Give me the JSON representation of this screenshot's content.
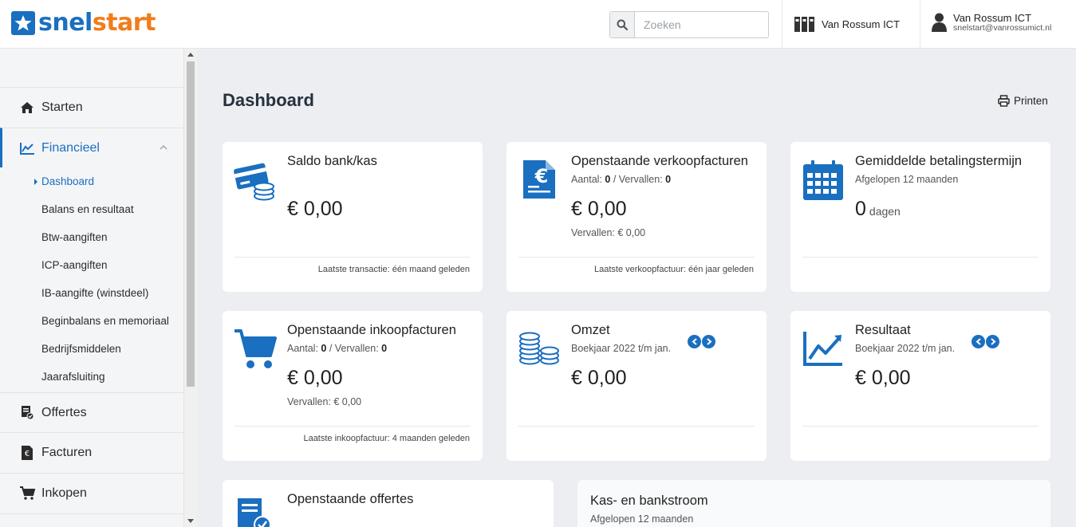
{
  "brand": {
    "part1": "snel",
    "part2": "start",
    "primary": "#1a6fc0",
    "accent": "#f07d1b"
  },
  "header": {
    "search_placeholder": "Zoeken",
    "company_name": "Van Rossum ICT",
    "user_name": "Van Rossum ICT",
    "user_email": "snelstart@vanrossumict.nl"
  },
  "sidebar": {
    "items": [
      {
        "label": "Starten",
        "icon": "home-icon"
      },
      {
        "label": "Financieel",
        "icon": "chart-line-icon"
      },
      {
        "label": "Offertes",
        "icon": "quote-doc-icon"
      },
      {
        "label": "Facturen",
        "icon": "invoice-euro-icon"
      },
      {
        "label": "Inkopen",
        "icon": "cart-icon"
      }
    ],
    "sub_items": [
      "Dashboard",
      "Balans en resultaat",
      "Btw-aangiften",
      "ICP-aangiften",
      "IB-aangifte (winstdeel)",
      "Beginbalans en memoriaal",
      "Bedrijfsmiddelen",
      "Jaarafsluiting"
    ],
    "active_sub": "Dashboard"
  },
  "main": {
    "title": "Dashboard",
    "print_label": "Printen",
    "cards": {
      "saldo": {
        "title": "Saldo bank/kas",
        "value": "€ 0,00",
        "footer": "Laatste transactie: één maand geleden"
      },
      "verkoop": {
        "title": "Openstaande verkoopfacturen",
        "count_label": "Aantal:",
        "count": "0",
        "overdue_label": "/ Vervallen:",
        "overdue": "0",
        "value": "€ 0,00",
        "extra": "Vervallen: € 0,00",
        "footer": "Laatste verkoopfactuur: één jaar geleden"
      },
      "termijn": {
        "title": "Gemiddelde betalingstermijn",
        "sub": "Afgelopen 12 maanden",
        "value": "0",
        "unit": "dagen"
      },
      "inkoop": {
        "title": "Openstaande inkoopfacturen",
        "count_label": "Aantal:",
        "count": "0",
        "overdue_label": "/ Vervallen:",
        "overdue": "0",
        "value": "€ 0,00",
        "extra": "Vervallen: € 0,00",
        "footer": "Laatste inkoopfactuur: 4 maanden geleden"
      },
      "omzet": {
        "title": "Omzet",
        "sub": "Boekjaar 2022 t/m jan.",
        "value": "€ 0,00"
      },
      "resultaat": {
        "title": "Resultaat",
        "sub": "Boekjaar 2022 t/m jan.",
        "value": "€ 0,00"
      },
      "offertes": {
        "title": "Openstaande offertes"
      },
      "kasstroom": {
        "title": "Kas- en bankstroom",
        "sub": "Afgelopen 12 maanden"
      }
    }
  }
}
